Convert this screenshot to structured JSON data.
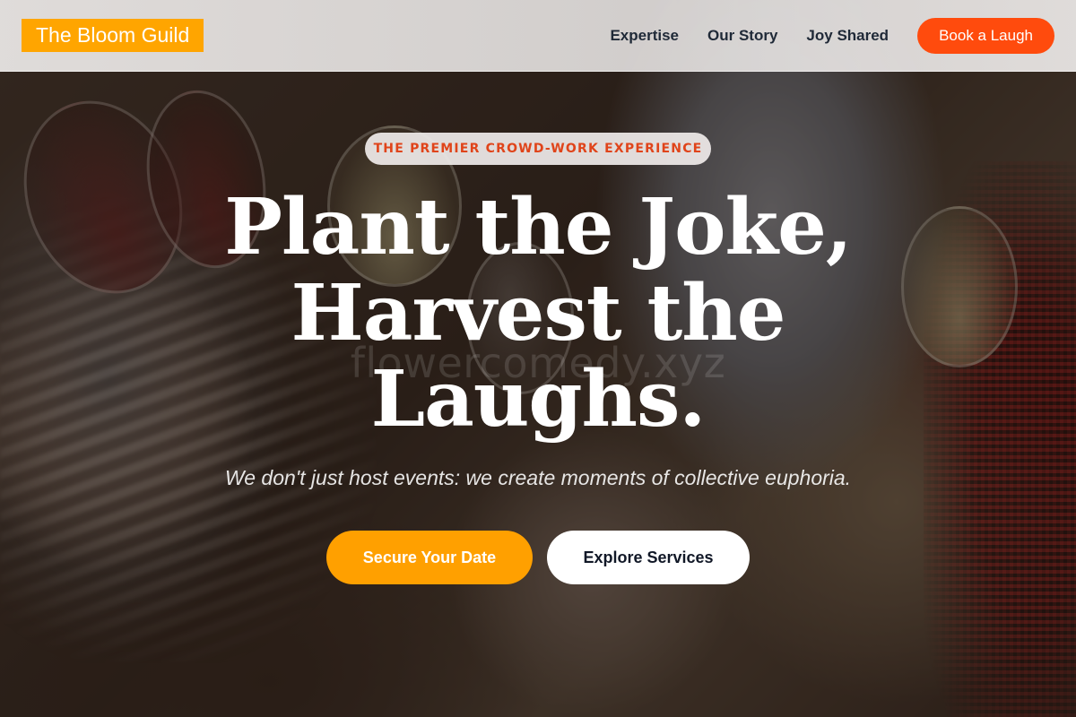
{
  "header": {
    "logo_text": "The Bloom Guild",
    "nav": [
      {
        "label": "Expertise"
      },
      {
        "label": "Our Story"
      },
      {
        "label": "Joy Shared"
      }
    ],
    "cta_label": "Book a Laugh"
  },
  "hero": {
    "eyebrow": "THE PREMIER CROWD-WORK EXPERIENCE",
    "headline_lines": [
      "Plant the Joke,",
      "Harvest the",
      "Laughs."
    ],
    "watermark": "flowercomedy.xyz",
    "subhead": "We don't just host events: we create moments of collective euphoria.",
    "primary_button": "Secure Your Date",
    "secondary_button": "Explore Services"
  },
  "colors": {
    "accent_orange": "#ffa500",
    "cta_red_orange": "#ff4b0d",
    "eyebrow_text": "#e0441a",
    "white": "#ffffff"
  }
}
